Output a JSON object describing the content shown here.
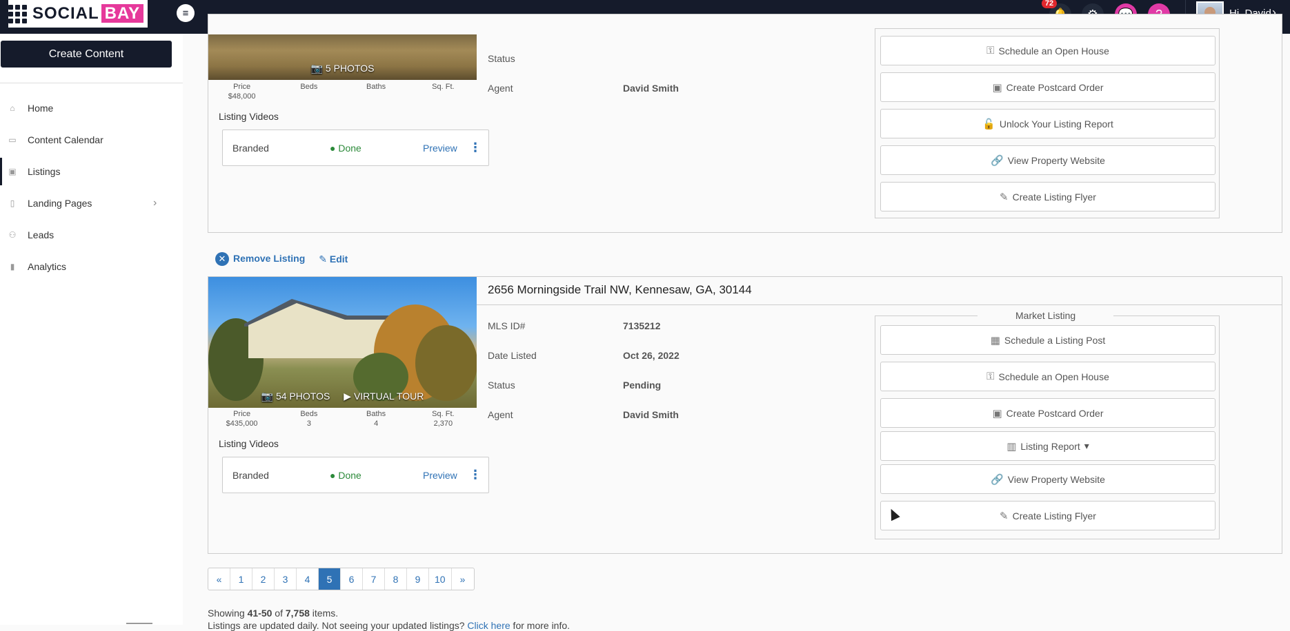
{
  "header": {
    "logo_word": "SOCIAL",
    "logo_accent": "BAY",
    "notification_count": "72",
    "greeting": "Hi, David",
    "icons": [
      "bell-icon",
      "gear-icon",
      "chat-icon",
      "help-icon"
    ]
  },
  "sidebar": {
    "create_label": "Create Content",
    "items": [
      {
        "label": "Home",
        "icon": "home-icon"
      },
      {
        "label": "Content Calendar",
        "icon": "calendar-icon"
      },
      {
        "label": "Listings",
        "icon": "listings-icon"
      },
      {
        "label": "Landing Pages",
        "icon": "pages-icon"
      },
      {
        "label": "Leads",
        "icon": "leads-icon"
      },
      {
        "label": "Analytics",
        "icon": "analytics-icon"
      }
    ]
  },
  "listing1": {
    "photo_caption": "5 PHOTOS",
    "stats": [
      {
        "label": "Price",
        "value": "$48,000"
      },
      {
        "label": "Beds",
        "value": ""
      },
      {
        "label": "Baths",
        "value": ""
      },
      {
        "label": "Sq. Ft.",
        "value": ""
      }
    ],
    "videos_title": "Listing Videos",
    "video": {
      "name": "Branded",
      "status": "Done",
      "preview": "Preview"
    },
    "details": [
      {
        "label": "Status",
        "value": ""
      },
      {
        "label": "Agent",
        "value": "David Smith"
      }
    ],
    "actions": [
      "Schedule an Open House",
      "Create Postcard Order",
      "Unlock Your Listing Report",
      "View Property Website",
      "Create Listing Flyer"
    ]
  },
  "listing_actions": {
    "remove": "Remove Listing",
    "edit": "Edit"
  },
  "listing2": {
    "address": "2656 Morningside Trail NW, Kennesaw, GA, 30144",
    "photo_caption": "54 PHOTOS",
    "tour_caption": "VIRTUAL TOUR",
    "stats": [
      {
        "label": "Price",
        "value": "$435,000"
      },
      {
        "label": "Beds",
        "value": "3"
      },
      {
        "label": "Baths",
        "value": "4"
      },
      {
        "label": "Sq. Ft.",
        "value": "2,370"
      }
    ],
    "videos_title": "Listing Videos",
    "video": {
      "name": "Branded",
      "status": "Done",
      "preview": "Preview"
    },
    "details": [
      {
        "label": "MLS ID#",
        "value": "7135212"
      },
      {
        "label": "Date Listed",
        "value": "Oct 26, 2022"
      },
      {
        "label": "Status",
        "value": "Pending"
      },
      {
        "label": "Agent",
        "value": "David Smith"
      }
    ],
    "actions_legend": "Market Listing",
    "actions": [
      "Schedule a Listing Post",
      "Schedule an Open House",
      "Create Postcard Order",
      "Listing Report",
      "View Property Website",
      "Create Listing Flyer"
    ]
  },
  "pagination": {
    "prev": "«",
    "pages": [
      "1",
      "2",
      "3",
      "4",
      "5",
      "6",
      "7",
      "8",
      "9",
      "10"
    ],
    "active": "5",
    "next": "»"
  },
  "footer": {
    "showing_prefix": "Showing ",
    "range": "41-50",
    "of": " of ",
    "total": "7,758",
    "suffix": " items.",
    "note": "Listings are updated daily. Not seeing your updated listings?",
    "note_link": "Click here",
    "note_suffix": " for more info."
  }
}
